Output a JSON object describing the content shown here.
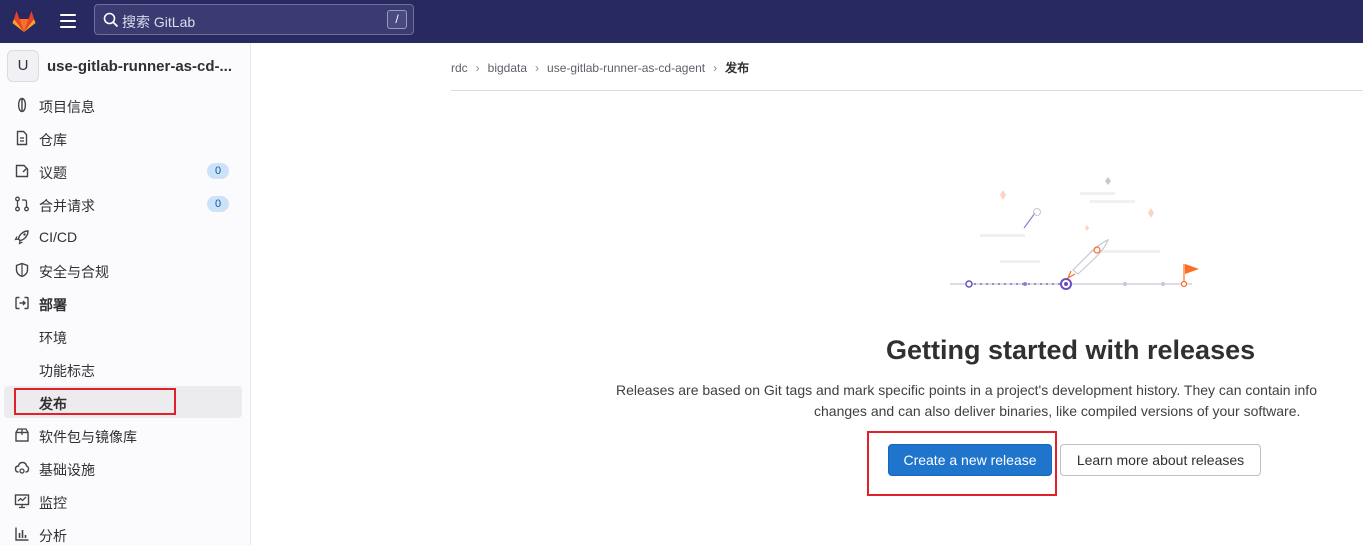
{
  "topbar": {
    "logo_icon": "gitlab-tanuki-icon",
    "menu_icon": "hamburger-icon",
    "search": {
      "placeholder": "搜索 GitLab",
      "shortcut": "/"
    }
  },
  "sidebar": {
    "project": {
      "avatar_letter": "U",
      "name": "use-gitlab-runner-as-cd-..."
    },
    "items": [
      {
        "label": "项目信息",
        "icon": "info-icon"
      },
      {
        "label": "仓库",
        "icon": "document-icon"
      },
      {
        "label": "议题",
        "icon": "issues-icon",
        "badge": "0"
      },
      {
        "label": "合并请求",
        "icon": "merge-request-icon",
        "badge": "0"
      },
      {
        "label": "CI/CD",
        "icon": "rocket-icon"
      },
      {
        "label": "安全与合规",
        "icon": "shield-icon"
      },
      {
        "label": "部署",
        "icon": "deploy-icon"
      }
    ],
    "deploy_sub": [
      "环境",
      "功能标志",
      "发布"
    ],
    "more_items": [
      {
        "label": "软件包与镜像库",
        "icon": "package-icon"
      },
      {
        "label": "基础设施",
        "icon": "cloud-gear-icon"
      },
      {
        "label": "监控",
        "icon": "monitor-icon"
      },
      {
        "label": "分析",
        "icon": "chart-icon"
      }
    ]
  },
  "breadcrumb": [
    "rdc",
    "bigdata",
    "use-gitlab-runner-as-cd-agent",
    "发布"
  ],
  "empty_state": {
    "title": "Getting started with releases",
    "description_line1": "Releases are based on Git tags and mark specific points in a project's development history. They can contain info",
    "description_line2": "changes and can also deliver binaries, like compiled versions of your software.",
    "primary_button": "Create a new release",
    "secondary_button": "Learn more about releases"
  },
  "colors": {
    "topbar": "#292961",
    "primary": "#1f75cb",
    "highlight": "#e0202a",
    "accent_purple": "#6b4fbb",
    "accent_orange": "#fc6d26"
  }
}
